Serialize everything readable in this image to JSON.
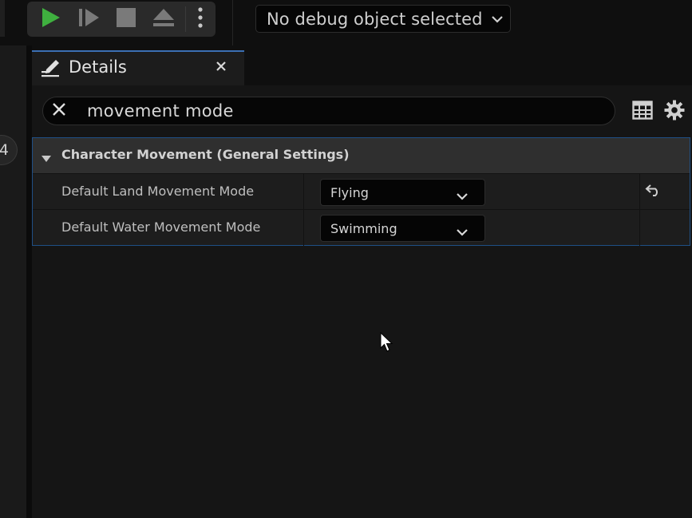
{
  "toolbar": {
    "debug_selector": {
      "label": "No debug object selected"
    },
    "buttons": {
      "play": "play-icon",
      "advance_frame": "advance-frame-icon",
      "stop": "stop-icon",
      "eject": "eject-icon",
      "more": "kebab-menu-icon"
    },
    "play_color": "#3fb03f"
  },
  "left_strip": {
    "badge": "4"
  },
  "details_tab": {
    "title": "Details",
    "icon": "details-pencil-icon",
    "close_icon": "close-icon",
    "accent_color": "#3b6fb3"
  },
  "search": {
    "value": "movement mode",
    "placeholder": "",
    "clear_icon": "close-icon"
  },
  "panel_buttons": {
    "table_view": "table-view-icon",
    "settings": "gear-icon"
  },
  "category": {
    "title": "Character Movement (General Settings)",
    "expanded": true,
    "rows": [
      {
        "name": "Default Land Movement Mode",
        "value": "Flying",
        "has_reset": true
      },
      {
        "name": "Default Water Movement Mode",
        "value": "Swimming",
        "has_reset": false
      }
    ]
  },
  "colors": {
    "background": "#151515",
    "selection_border": "#1f4f86",
    "header_bg": "#2f2f2f"
  }
}
